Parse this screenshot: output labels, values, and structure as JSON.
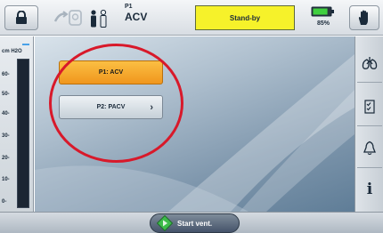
{
  "topbar": {
    "profile_label": "P1",
    "mode": "ACV",
    "status": "Stand-by",
    "battery_percent": "85%",
    "battery_level": 0.85
  },
  "pressure_gauge": {
    "unit": "cm H2O",
    "ticks": [
      "60-",
      "50-",
      "40-",
      "30-",
      "20-",
      "10-",
      "0-"
    ]
  },
  "profiles": [
    {
      "label": "P1: ACV",
      "selected": true
    },
    {
      "label": "P2: PACV",
      "selected": false,
      "arrow": "›"
    }
  ],
  "sidebar": {
    "items": [
      {
        "icon": "lungs-icon"
      },
      {
        "icon": "checklist-icon"
      },
      {
        "icon": "bell-icon"
      },
      {
        "icon": "info-icon",
        "label": "i"
      }
    ]
  },
  "bottom": {
    "start_label": "Start vent."
  },
  "colors": {
    "status_bg": "#f6f22a",
    "selected_profile": "#f0961d",
    "annotation": "#d8192a"
  }
}
